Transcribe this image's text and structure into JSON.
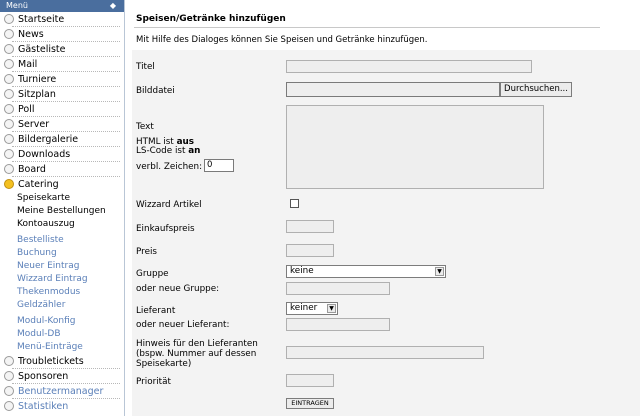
{
  "menu": {
    "header": "Menü",
    "pin": "◆",
    "items": [
      {
        "label": "Startseite",
        "active": false
      },
      {
        "label": "News",
        "active": false
      },
      {
        "label": "Gästeliste",
        "active": false
      },
      {
        "label": "Mail",
        "active": false
      },
      {
        "label": "Turniere",
        "active": false
      },
      {
        "label": "Sitzplan",
        "active": false
      },
      {
        "label": "Poll",
        "active": false
      },
      {
        "label": "Server",
        "active": false
      },
      {
        "label": "Bildergalerie",
        "active": false
      },
      {
        "label": "Downloads",
        "active": false
      },
      {
        "label": "Board",
        "active": false
      },
      {
        "label": "Catering",
        "active": true
      }
    ],
    "catering_sub": [
      "Speisekarte",
      "Meine Bestellungen",
      "Kontoauszug",
      "Bestelliste",
      "Buchung",
      "Neuer Eintrag",
      "Wizzard Eintrag",
      "Thekenmodus",
      "Geldzähler",
      "Modul-Konfig",
      "Modul-DB",
      "Menü-Einträge"
    ],
    "after_items": [
      {
        "label": "Troubletickets"
      },
      {
        "label": "Sponsoren"
      },
      {
        "label": "Benutzermanager"
      },
      {
        "label": "Statistiken"
      }
    ]
  },
  "page": {
    "title": "Speisen/Getränke hinzufügen",
    "description": "Mit Hilfe des Dialoges können Sie Speisen und Getränke hinzufügen."
  },
  "form": {
    "titel_label": "Titel",
    "bilddatei_label": "Bilddatei",
    "browse_button": "Durchsuchen...",
    "text_label": "Text",
    "html_pre": "HTML ist ",
    "html_state": "aus",
    "ls_pre": "LS-Code ist ",
    "ls_state": "an",
    "chars_label": "verbl. Zeichen:",
    "chars_value": "0",
    "wizzard_label": "Wizzard Artikel",
    "einkaufspreis_label": "Einkaufspreis",
    "preis_label": "Preis",
    "gruppe_label": "Gruppe",
    "gruppe_value": "keine",
    "neue_gruppe_label": "oder neue Gruppe:",
    "lieferant_label": "Lieferant",
    "lieferant_value": "keiner",
    "neuer_lieferant_label": "oder neuer Lieferant:",
    "hinweis_label_1": "Hinweis für den Lieferanten",
    "hinweis_label_2": "(bspw. Nummer auf dessen",
    "hinweis_label_3": "Speisekarte)",
    "prioritaet_label": "Priorität",
    "submit_button": "EINTRAGEN"
  }
}
